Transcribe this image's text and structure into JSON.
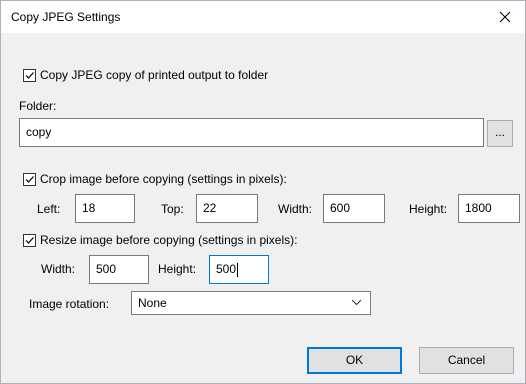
{
  "window": {
    "title": "Copy JPEG Settings",
    "close_glyph": "✕"
  },
  "copy_to_folder": {
    "checked": true,
    "label": "Copy JPEG copy of printed output to folder"
  },
  "folder": {
    "label": "Folder:",
    "value": "copy",
    "browse_label": "..."
  },
  "crop": {
    "checked": true,
    "label": "Crop image before copying (settings in pixels):",
    "left_label": "Left:",
    "left_value": "18",
    "top_label": "Top:",
    "top_value": "22",
    "width_label": "Width:",
    "width_value": "600",
    "height_label": "Height:",
    "height_value": "1800"
  },
  "resize": {
    "checked": true,
    "label": "Resize image before copying (settings in pixels):",
    "width_label": "Width:",
    "width_value": "500",
    "height_label": "Height:",
    "height_value": "500"
  },
  "rotation": {
    "label": "Image rotation:",
    "value": "None"
  },
  "buttons": {
    "ok": "OK",
    "cancel": "Cancel"
  },
  "icons": {
    "close": "close-icon",
    "checkmark": "checkmark-icon",
    "dropdown": "chevron-down-icon"
  },
  "colors": {
    "focus_border": "#0078d7",
    "dialog_bg": "#f0f0f0"
  }
}
